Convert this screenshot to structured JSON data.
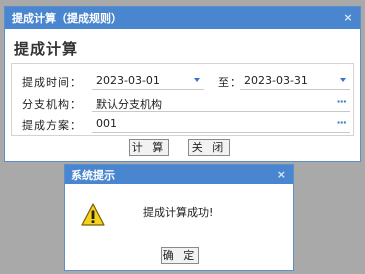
{
  "main_dialog": {
    "title": "提成计算（提成规则）",
    "close_glyph": "×",
    "heading": "提成计算",
    "fields": {
      "time_label": "提成时间：",
      "start_date": "2023-03-01",
      "to_label": "至：",
      "end_date": "2023-03-31",
      "branch_label": "分支机构：",
      "branch_value": "默认分支机构",
      "scheme_label": "提成方案：",
      "scheme_value": "001"
    },
    "buttons": {
      "calculate": "计 算",
      "close": "关 闭"
    }
  },
  "message_dialog": {
    "title": "系统提示",
    "close_glyph": "×",
    "text": "提成计算成功!",
    "ok": "确 定"
  },
  "colors": {
    "titlebar": "#4a86cf",
    "accent": "#3b74c6",
    "warning": "#f5d21c"
  }
}
